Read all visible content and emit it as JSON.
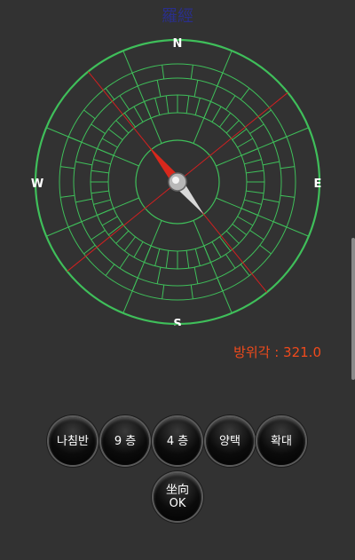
{
  "title": "羅經",
  "compass": {
    "north": "N",
    "south": "S",
    "east": "E",
    "west": "W",
    "heading_deg": 321.0,
    "ring_color": "#3fbf5a",
    "needle_north_color": "#d8281c",
    "needle_south_color": "#d8d8d8",
    "axis_line_color": "#d02020"
  },
  "heading_text": "방위각 : 321.0",
  "buttons": [
    {
      "label": "나침반"
    },
    {
      "label": "9 층"
    },
    {
      "label": "4 층"
    },
    {
      "label": "양택"
    },
    {
      "label": "확대"
    }
  ],
  "ok_button": {
    "line1": "坐向",
    "line2": "OK"
  }
}
